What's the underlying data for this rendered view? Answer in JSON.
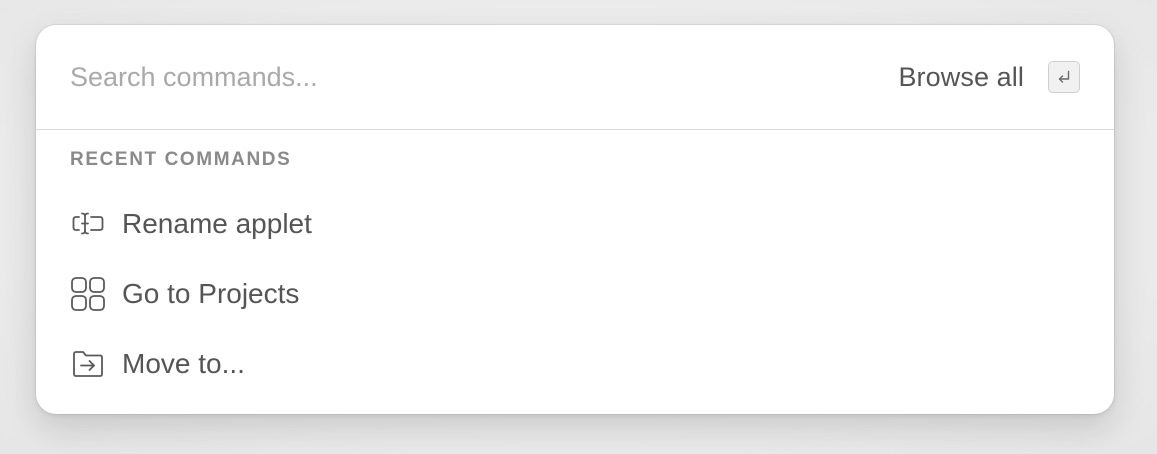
{
  "search": {
    "placeholder": "Search commands...",
    "value": ""
  },
  "browse_all": {
    "label": "Browse all",
    "shortcut_icon": "return-key-icon"
  },
  "recent": {
    "title": "RECENT COMMANDS",
    "items": [
      {
        "label": "Rename applet",
        "icon": "rename-text-cursor-icon"
      },
      {
        "label": "Go to Projects",
        "icon": "grid-four-squares-icon"
      },
      {
        "label": "Move to...",
        "icon": "folder-arrow-icon"
      }
    ]
  },
  "colors": {
    "panel": "#ffffff",
    "text": "#555555",
    "placeholder": "#a9a9a9",
    "section_title": "#8a8a8a",
    "divider": "#d9d9d9"
  }
}
